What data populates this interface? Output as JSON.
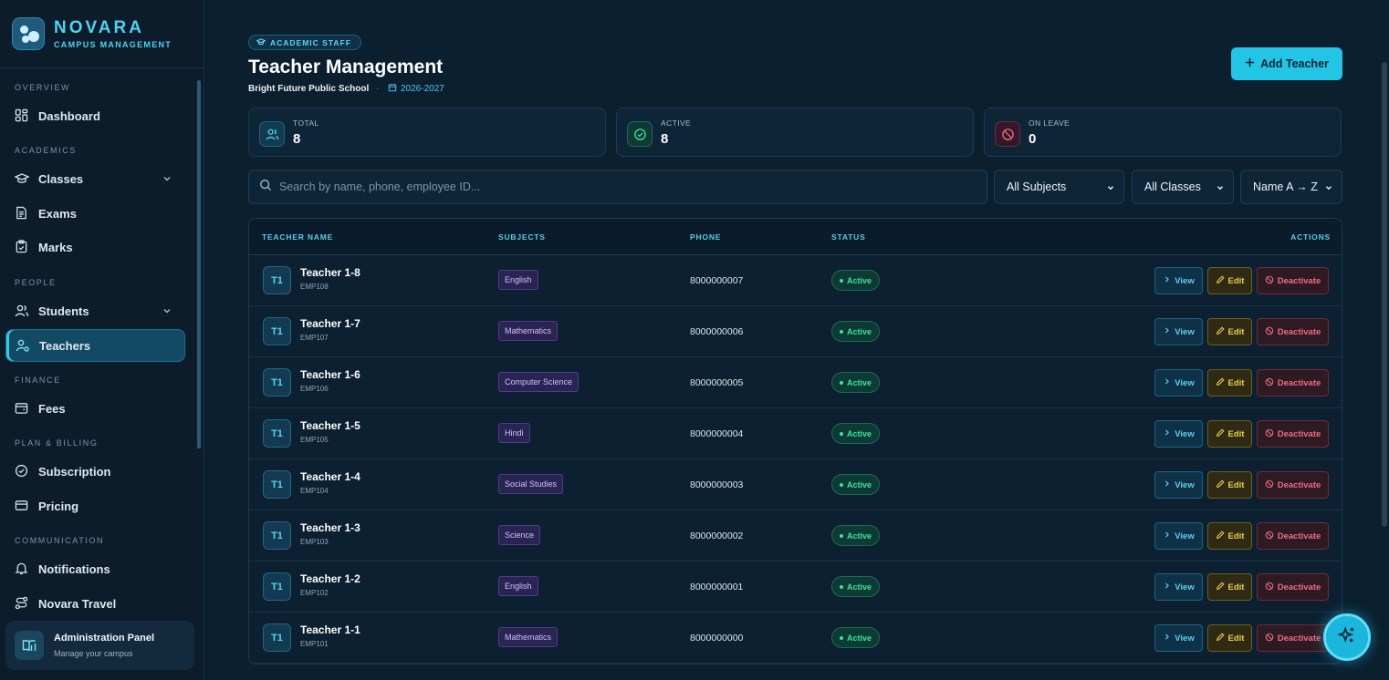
{
  "brand": {
    "name": "NOVARA",
    "subtitle": "CAMPUS MANAGEMENT"
  },
  "sidebar": {
    "sections": [
      {
        "label": "OVERVIEW"
      },
      {
        "label": "ACADEMICS"
      },
      {
        "label": "PEOPLE"
      },
      {
        "label": "FINANCE"
      },
      {
        "label": "PLAN & BILLING"
      },
      {
        "label": "COMMUNICATION"
      }
    ],
    "items": [
      {
        "label": "Dashboard",
        "icon": "dashboard-icon"
      },
      {
        "label": "Classes",
        "icon": "graduation-cap-icon",
        "expandable": true
      },
      {
        "label": "Exams",
        "icon": "document-icon"
      },
      {
        "label": "Marks",
        "icon": "clipboard-check-icon"
      },
      {
        "label": "Students",
        "icon": "users-icon",
        "expandable": true
      },
      {
        "label": "Teachers",
        "icon": "user-cog-icon",
        "active": true
      },
      {
        "label": "Fees",
        "icon": "wallet-icon"
      },
      {
        "label": "Subscription",
        "icon": "check-circle-icon"
      },
      {
        "label": "Pricing",
        "icon": "credit-card-icon"
      },
      {
        "label": "Notifications",
        "icon": "bell-icon"
      },
      {
        "label": "Novara Travel",
        "icon": "route-icon"
      }
    ],
    "admin": {
      "title": "Administration Panel",
      "subtitle": "Manage your campus"
    }
  },
  "header": {
    "badge": "ACADEMIC STAFF",
    "title": "Teacher Management",
    "school": "Bright Future Public School",
    "separator": "·",
    "year": "2026-2027",
    "add_button": "Add Teacher"
  },
  "stats": [
    {
      "label": "TOTAL",
      "value": "8",
      "icon": "users-icon"
    },
    {
      "label": "ACTIVE",
      "value": "8",
      "icon": "check-circle-icon"
    },
    {
      "label": "ON LEAVE",
      "value": "0",
      "icon": "leave-icon"
    }
  ],
  "filters": {
    "search_placeholder": "Search by name, phone, employee ID...",
    "subject": "All Subjects",
    "class": "All Classes",
    "sort": "Name A → Z"
  },
  "table": {
    "headers": {
      "name": "TEACHER NAME",
      "subjects": "SUBJECTS",
      "phone": "PHONE",
      "status": "STATUS",
      "actions": "ACTIONS"
    },
    "actions": {
      "view": "View",
      "edit": "Edit",
      "deactivate": "Deactivate"
    },
    "rows": [
      {
        "initials": "T1",
        "name": "Teacher 1-8",
        "emp": "EMP108",
        "subject": "English",
        "phone": "8000000007",
        "status": "Active"
      },
      {
        "initials": "T1",
        "name": "Teacher 1-7",
        "emp": "EMP107",
        "subject": "Mathematics",
        "phone": "8000000006",
        "status": "Active"
      },
      {
        "initials": "T1",
        "name": "Teacher 1-6",
        "emp": "EMP106",
        "subject": "Computer Science",
        "phone": "8000000005",
        "status": "Active"
      },
      {
        "initials": "T1",
        "name": "Teacher 1-5",
        "emp": "EMP105",
        "subject": "Hindi",
        "phone": "8000000004",
        "status": "Active"
      },
      {
        "initials": "T1",
        "name": "Teacher 1-4",
        "emp": "EMP104",
        "subject": "Social Studies",
        "phone": "8000000003",
        "status": "Active"
      },
      {
        "initials": "T1",
        "name": "Teacher 1-3",
        "emp": "EMP103",
        "subject": "Science",
        "phone": "8000000002",
        "status": "Active"
      },
      {
        "initials": "T1",
        "name": "Teacher 1-2",
        "emp": "EMP102",
        "subject": "English",
        "phone": "8000000001",
        "status": "Active"
      },
      {
        "initials": "T1",
        "name": "Teacher 1-1",
        "emp": "EMP101",
        "subject": "Mathematics",
        "phone": "8000000000",
        "status": "Active"
      }
    ]
  },
  "colors": {
    "accent": "#22c5e6",
    "active": "#3fe0a7",
    "edit": "#f0cd4a",
    "danger": "#f06b86",
    "subject": "#cfc3ff"
  }
}
